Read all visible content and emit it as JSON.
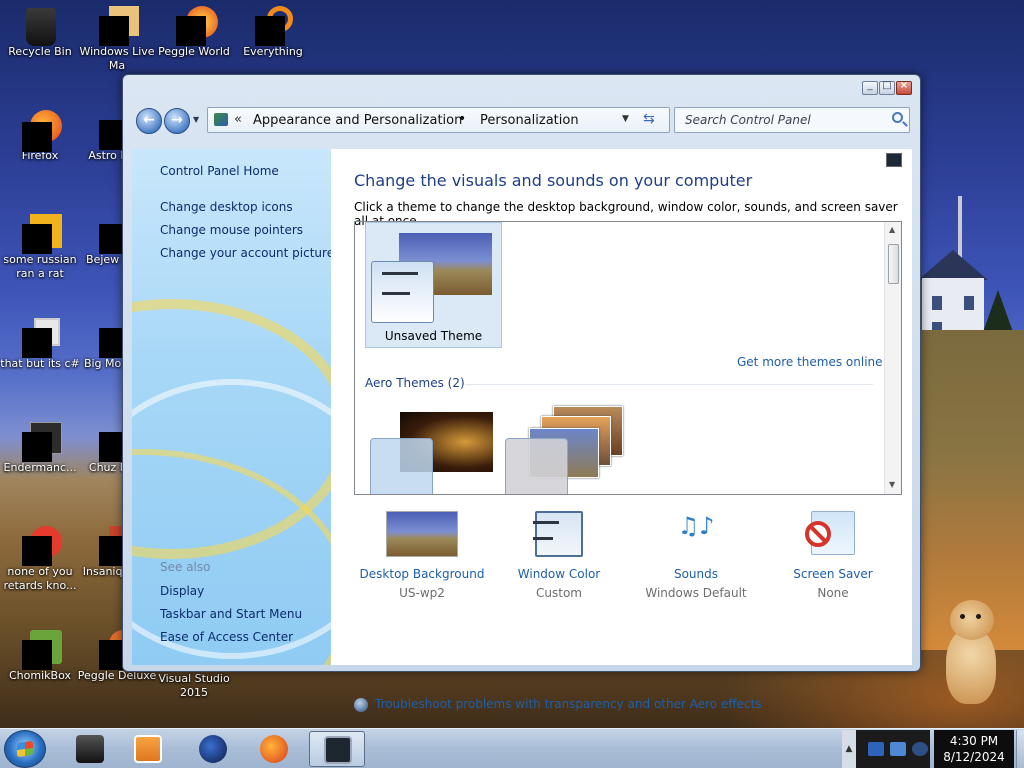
{
  "desktop": {
    "icons": [
      {
        "label": "Recycle Bin"
      },
      {
        "label": "Windows Live Ma"
      },
      {
        "label": "Peggle World"
      },
      {
        "label": "Everything"
      },
      {
        "label": "Firefox"
      },
      {
        "label": "Astro Delu"
      },
      {
        "label": "some russian ran a rat"
      },
      {
        "label": "Bejew Delu"
      },
      {
        "label": "that but its c#"
      },
      {
        "label": "Big Mo Delu"
      },
      {
        "label": "Endermanc..."
      },
      {
        "label": "Chuz Delu"
      },
      {
        "label": "none of you retards kno..."
      },
      {
        "label": "Insaniq Delu"
      },
      {
        "label": "ChomikBox"
      },
      {
        "label": "Peggle Deluxe"
      },
      {
        "label": "Visual Studio 2015"
      }
    ]
  },
  "window": {
    "nav": {
      "crumb1": "Appearance and Personalization",
      "separator": "•",
      "crumb2": "Personalization",
      "search_placeholder": "Search Control Panel"
    },
    "left_pane": {
      "home": "Control Panel Home",
      "links": [
        "Change desktop icons",
        "Change mouse pointers",
        "Change your account picture"
      ],
      "see_also_title": "See also",
      "see_also": [
        "Display",
        "Taskbar and Start Menu",
        "Ease of Access Center"
      ]
    },
    "content": {
      "title": "Change the visuals and sounds on your computer",
      "description": "Click a theme to change the desktop background, window color, sounds, and screen saver all at once.",
      "selected_theme": "Unsaved Theme",
      "more_themes": "Get more themes online",
      "aero_header": "Aero Themes (2)",
      "settings": [
        {
          "label": "Desktop Background",
          "value": "US-wp2",
          "icon": "desktop-background-icon"
        },
        {
          "label": "Window Color",
          "value": "Custom",
          "icon": "window-color-icon"
        },
        {
          "label": "Sounds",
          "value": "Windows Default",
          "icon": "sounds-icon"
        },
        {
          "label": "Screen Saver",
          "value": "None",
          "icon": "screen-saver-icon"
        }
      ],
      "troubleshoot": "Troubleshoot problems with transparency and other Aero effects"
    }
  },
  "taskbar": {
    "clock_time": "4:30 PM",
    "clock_date": "8/12/2024"
  },
  "colors": {
    "link": "#1e5fa8",
    "heading": "#1e3f87",
    "taskbar": "#a9bdd6"
  }
}
